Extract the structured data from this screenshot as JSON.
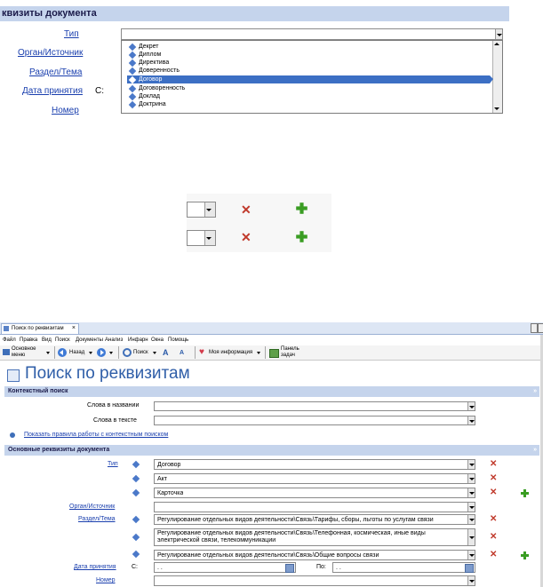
{
  "top": {
    "section_title": "квизиты документа",
    "labels": {
      "tip": "Тип",
      "organ": "Орган/Источник",
      "razdel": "Раздел/Тема",
      "data": "Дата принятия",
      "c": "С:",
      "nomer": "Номер"
    },
    "dropdown_items": [
      "Декрет",
      "Диплом",
      "Директива",
      "Доверенность",
      "Договор",
      "Договоренность",
      "Доклад",
      "Доктрина"
    ],
    "selected_index": 4
  },
  "mid": {
    "x_label": "✕"
  },
  "app": {
    "tab_title": "Поиск по реквизитам",
    "tab_close": "×",
    "menu": [
      "Файл",
      "Правка",
      "Вид",
      "Поиск",
      "Документы",
      "Анализ",
      "Инфарн",
      "Окна",
      "Помощь"
    ],
    "toolbar": {
      "main_menu_1": "Основное",
      "main_menu_2": "меню",
      "back": "Назад",
      "search": "Поиск",
      "my_info": "Моя информация",
      "panel_1": "Панель",
      "panel_2": "задач"
    },
    "page_title": "Поиск по реквизитам",
    "context_section": "Контекстный поиск",
    "words_in_title": "Слова в названии",
    "words_in_text": "Слова в тексте",
    "rules_link": "Показать правила работы с контекстным поиском",
    "main_section": "Основные реквизиты документа",
    "tip_label": "Тип",
    "tip_values": [
      "Договор",
      "Акт",
      "Карточка"
    ],
    "organ_label": "Орган/Источник",
    "razdel_label": "Раздел/Тема",
    "razdel_values": [
      "Регулирование отдельных видов деятельности\\Связь\\Тарифы, сборы, льготы по услугам связи",
      "Регулирование отдельных видов деятельности\\Связь\\Телефонная, космическая, иные виды электрической связи, телекоммуникации",
      "Регулирование отдельных видов деятельности\\Связь\\Общие вопросы связи"
    ],
    "date_label": "Дата принятия",
    "from_label": "С:",
    "to_label": "По:",
    "date_placeholder": ". .",
    "nomer_label": "Номер",
    "collapse_glyph": "»"
  }
}
